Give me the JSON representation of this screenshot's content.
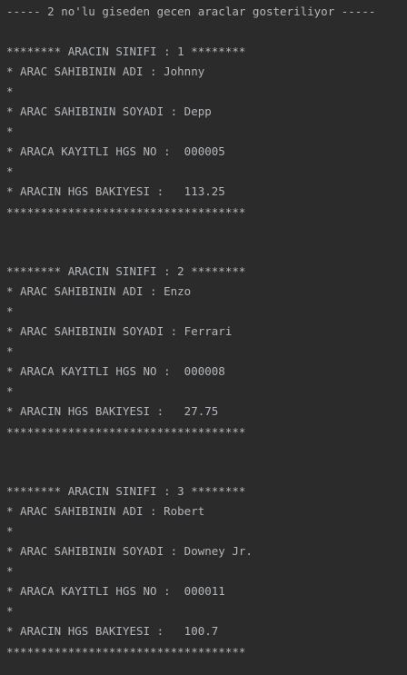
{
  "console": {
    "header": "----- 2 no'lu giseden gecen araclar gosteriliyor -----",
    "vehicles": [
      {
        "class_line": "******** ARACIN SINIFI : 1 ********",
        "owner_name": "* ARAC SAHIBININ ADI : Johnny",
        "sep1": "*",
        "owner_surname": "* ARAC SAHIBININ SOYADI : Depp",
        "sep2": "*",
        "hgs_no": "* ARACA KAYITLI HGS NO :  000005",
        "sep3": "*",
        "balance": "* ARACIN HGS BAKIYESI :   113.25",
        "footer": "***********************************"
      },
      {
        "class_line": "******** ARACIN SINIFI : 2 ********",
        "owner_name": "* ARAC SAHIBININ ADI : Enzo",
        "sep1": "*",
        "owner_surname": "* ARAC SAHIBININ SOYADI : Ferrari",
        "sep2": "*",
        "hgs_no": "* ARACA KAYITLI HGS NO :  000008",
        "sep3": "*",
        "balance": "* ARACIN HGS BAKIYESI :   27.75",
        "footer": "***********************************"
      },
      {
        "class_line": "******** ARACIN SINIFI : 3 ********",
        "owner_name": "* ARAC SAHIBININ ADI : Robert",
        "sep1": "*",
        "owner_surname": "* ARAC SAHIBININ SOYADI : Downey Jr.",
        "sep2": "*",
        "hgs_no": "* ARACA KAYITLI HGS NO :  000011",
        "sep3": "*",
        "balance": "* ARACIN HGS BAKIYESI :   100.7",
        "footer": "***********************************"
      }
    ]
  }
}
